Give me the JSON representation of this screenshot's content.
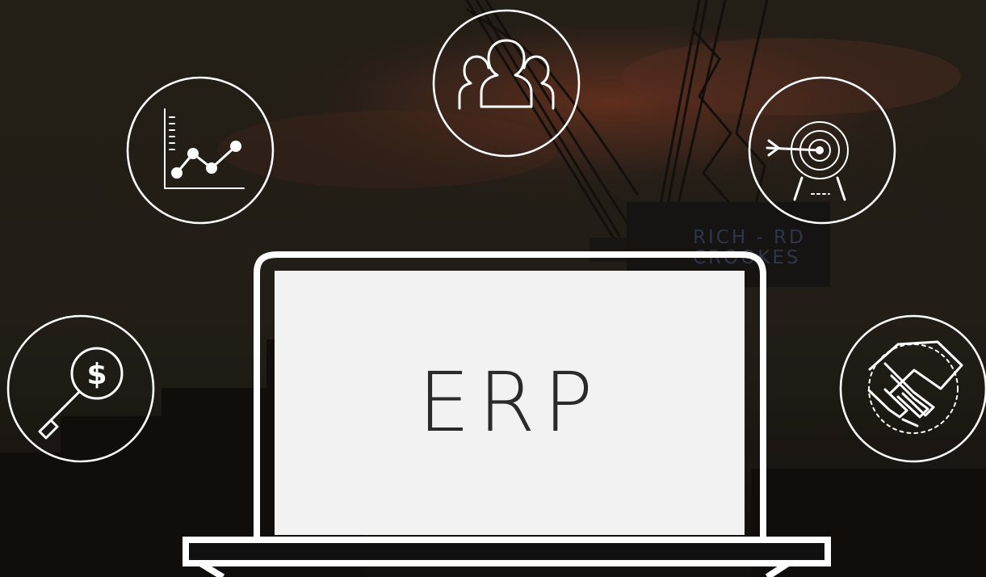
{
  "screen": {
    "title": "ERP"
  },
  "signage": {
    "line1": "RICH - RD",
    "line2": "CROOKES"
  },
  "icons": [
    "analytics-chart-icon",
    "team-people-icon",
    "target-arrow-icon",
    "dollar-search-icon",
    "handshake-icon",
    "laptop-icon"
  ],
  "colors": {
    "background": "#2a241c",
    "sky_glow": "#7b3a23",
    "crane": "#17130f",
    "icon_stroke": "#ffffff",
    "screen": "#f2f2f2",
    "screen_text": "#2a2a2a"
  }
}
